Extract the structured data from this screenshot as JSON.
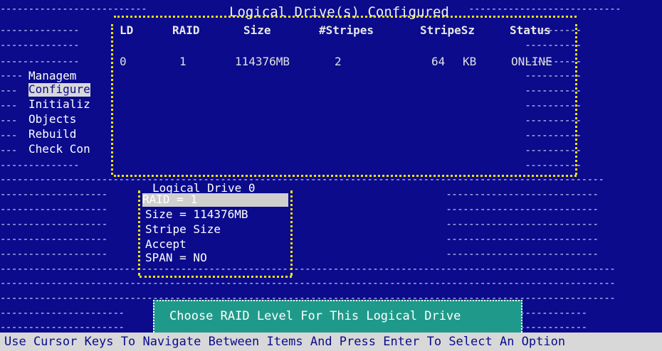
{
  "title": "Logical Drive(s) Configured",
  "columns": [
    "LD",
    "RAID",
    "Size",
    "#Stripes",
    "StripeSz",
    "Status"
  ],
  "row": {
    "ld": "0",
    "raid": "1",
    "size": "114376MB",
    "stripes": "2",
    "stripesz": "64",
    "stripeunit": "KB",
    "status": "ONLINE"
  },
  "menu": [
    "Managem",
    "Configure",
    "Initializ",
    "Objects",
    "Rebuild",
    "Check Con"
  ],
  "popup": {
    "title": "Logical Drive 0",
    "items": [
      "RAID = 1",
      "Size = 114376MB",
      "Stripe Size",
      "Accept",
      "SPAN = NO"
    ]
  },
  "status_message": "Choose RAID Level For This Logical Drive",
  "help": "Use Cursor Keys To Navigate Between Items And Press Enter To Select An Option",
  "colors": {
    "background": "#0b0b8c",
    "highlight": "#d8d8d8",
    "border": "#f4e200",
    "status_box": "#1f9a8a"
  }
}
